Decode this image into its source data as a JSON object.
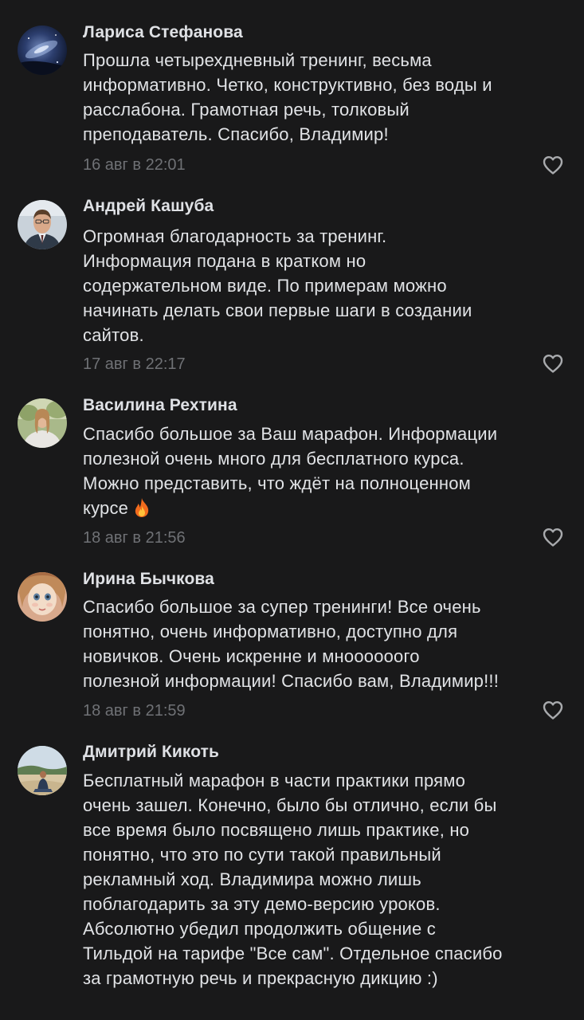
{
  "colors": {
    "background": "#19191a",
    "author": "#dfe1e5",
    "text": "#e1e3e6",
    "date": "#6f7175",
    "like_icon": "#a8aaad"
  },
  "comments": [
    {
      "author": "Лариса Стефанова",
      "avatar": "avatar-space-photo",
      "lines": [
        "Прошла четырехдневный тренинг, весьма",
        "информативно. Четко, конструктивно, без воды и",
        "расслабона. Грамотная речь, толковый",
        "преподаватель. Спасибо, Владимир!"
      ],
      "date": "16 авг в 22:01",
      "like_icon": "heart-outline-icon"
    },
    {
      "author": "Андрей Кашуба",
      "avatar": "avatar-man-photo",
      "lines": [
        "Огромная благодарность за тренинг.",
        "Информация подана в кратком но",
        "содержательном виде. По примерам можно",
        "начинать делать свои первые шаги в создании",
        "сайтов."
      ],
      "date": "17 авг в 22:17",
      "like_icon": "heart-outline-icon"
    },
    {
      "author": "Василина Рехтина",
      "avatar": "avatar-woman-outdoor-photo",
      "lines": [
        "Спасибо большое за Ваш марафон. Информации",
        "полезной очень много для бесплатного курса.",
        "Можно представить, что ждёт на полноценном",
        "курсе"
      ],
      "emoji": "fire-emoji",
      "date": "18 авг в 21:56",
      "like_icon": "heart-outline-icon"
    },
    {
      "author": "Ирина Бычкова",
      "avatar": "avatar-doll-photo",
      "lines": [
        "Спасибо большое за супер тренинги! Все очень",
        "понятно, очень информативно, доступно для",
        "новичков. Очень искренне и мноооооого",
        "полезной информации! Спасибо вам, Владимир!!!"
      ],
      "date": "18 авг в 21:59",
      "like_icon": "heart-outline-icon"
    },
    {
      "author": "Дмитрий Кикоть",
      "avatar": "avatar-beach-photo",
      "lines": [
        "Бесплатный марафон в части практики прямо",
        "очень зашел. Конечно, было бы отлично, если бы",
        "все время было посвящено лишь практике, но",
        "понятно, что это по сути такой правильный",
        "рекламный ход. Владимира можно лишь",
        "поблагодарить за эту демо-версию уроков.",
        "Абсолютно убедил продолжить общение с",
        "Тильдой на тарифе \"Все сам\". Отдельное спасибо",
        "за грамотную речь и прекрасную дикцию :)"
      ]
    }
  ]
}
